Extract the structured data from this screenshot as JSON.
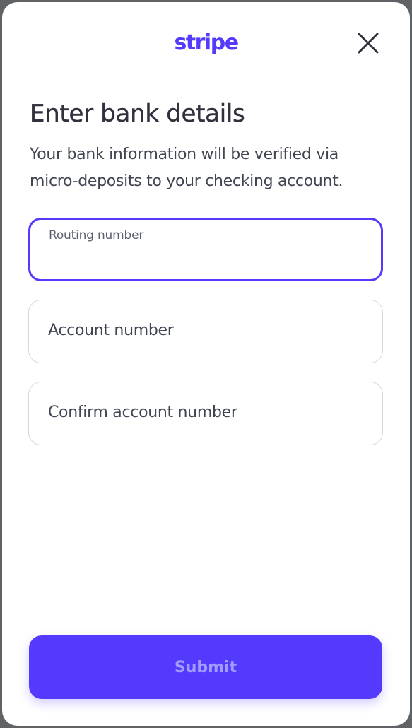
{
  "header": {
    "logo_text": "stripe",
    "close_icon": "close-icon",
    "brand_color": "#533afd"
  },
  "main": {
    "title": "Enter bank details",
    "subtitle": "Your bank information will be verified via micro-deposits to your checking account."
  },
  "form": {
    "routing": {
      "label": "Routing number",
      "value": ""
    },
    "account": {
      "placeholder": "Account number",
      "value": ""
    },
    "confirm": {
      "placeholder": "Confirm account number",
      "value": ""
    }
  },
  "footer": {
    "submit_label": "Submit"
  }
}
